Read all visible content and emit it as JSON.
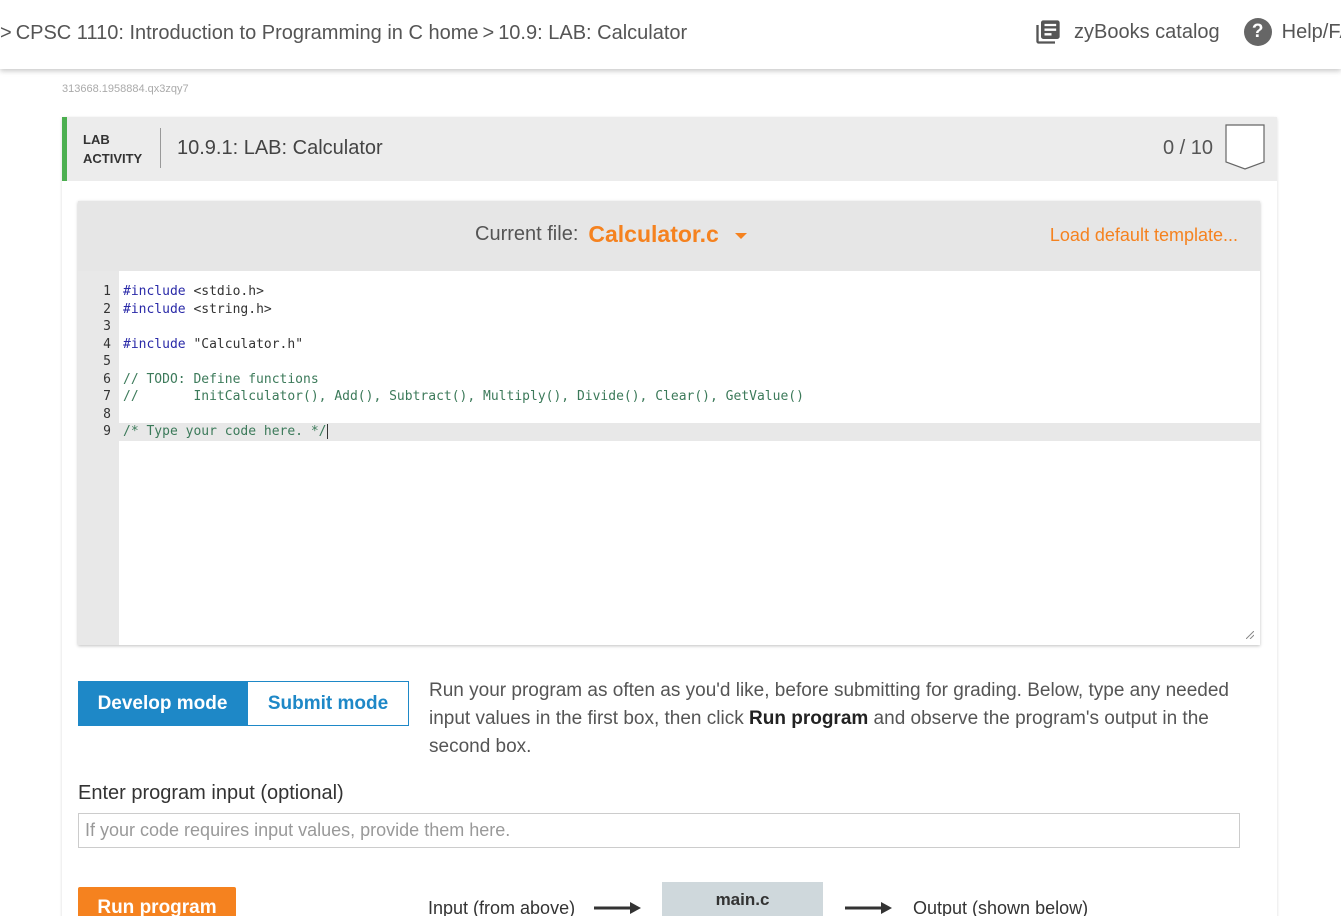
{
  "breadcrumb": {
    "items": [
      ">",
      "CPSC 1110: Introduction to Programming in C home",
      ">",
      "10.9: LAB: Calculator"
    ]
  },
  "header": {
    "catalog_label": "zyBooks catalog",
    "help_label": "Help/FAQ",
    "help_glyph": "?"
  },
  "resource_id": "313668.1958884.qx3zqy7",
  "lab": {
    "tag_line1": "LAB",
    "tag_line2": "ACTIVITY",
    "title": "10.9.1: LAB: Calculator",
    "score": "0 / 10"
  },
  "editor": {
    "current_file_label": "Current file:",
    "current_file": "Calculator.c",
    "load_default": "Load default template...",
    "lines": [
      {
        "n": "1",
        "text": "#include <stdio.h>"
      },
      {
        "n": "2",
        "text": "#include <string.h>"
      },
      {
        "n": "3",
        "text": ""
      },
      {
        "n": "4",
        "text": "#include \"Calculator.h\""
      },
      {
        "n": "5",
        "text": ""
      },
      {
        "n": "6",
        "text": "// TODO: Define functions"
      },
      {
        "n": "7",
        "text": "//       InitCalculator(), Add(), Subtract(), Multiply(), Divide(), Clear(), GetValue()"
      },
      {
        "n": "8",
        "text": ""
      },
      {
        "n": "9",
        "text": "/* Type your code here. */"
      }
    ]
  },
  "modes": {
    "develop": "Develop mode",
    "submit": "Submit mode",
    "desc_part1": "Run your program as often as you'd like, before submitting for grading. Below, type any needed input values in the first box, then click ",
    "desc_bold": "Run program",
    "desc_part2": " and observe the program's output in the second box."
  },
  "input": {
    "label": "Enter program input (optional)",
    "placeholder": "If your code requires input values, provide them here.",
    "value": ""
  },
  "run": {
    "button": "Run program",
    "flow_input": "Input (from above)",
    "main_file": "main.c",
    "flow_output": "Output (shown below)"
  },
  "colors": {
    "accent_orange": "#f5821f",
    "accent_blue": "#1e88c7",
    "lab_green": "#4caf50"
  },
  "icons": {
    "catalog": "catalog-book-icon",
    "help": "help-question-icon",
    "badge": "completion-badge-icon",
    "dropdown": "dropdown-caret-icon",
    "arrow": "arrow-right-icon",
    "resize": "resize-handle-icon"
  }
}
